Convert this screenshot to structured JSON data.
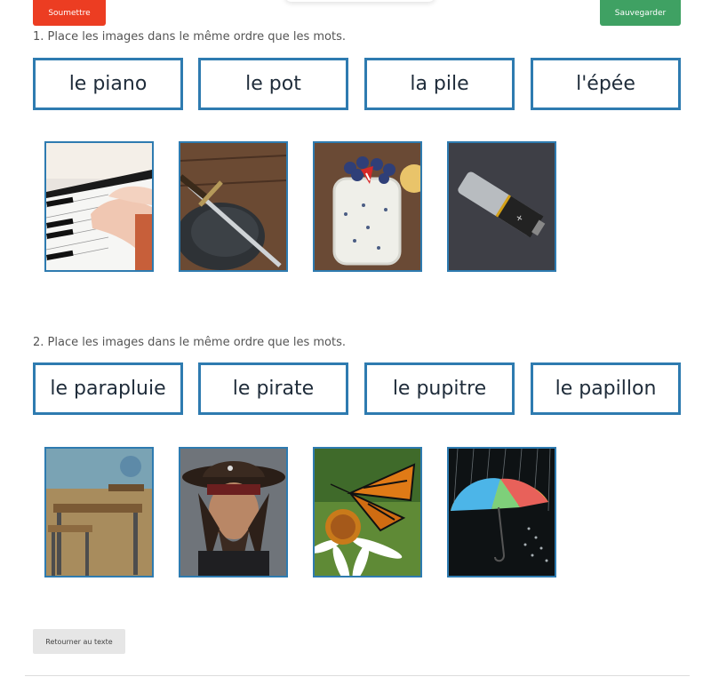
{
  "header": {
    "submit_label": "Soumettre",
    "save_label": "Sauvegarder"
  },
  "colors": {
    "submit": "#ec3d22",
    "save": "#3fa163",
    "border": "#2e7bb0"
  },
  "exercises": [
    {
      "instruction": "1. Place les images dans le même ordre que les mots.",
      "words": [
        "le piano",
        "le pot",
        "la pile",
        "l'épée"
      ],
      "images": [
        "piano-image",
        "sword-image",
        "yogurt-jar-image",
        "battery-image"
      ]
    },
    {
      "instruction": "2. Place les images dans le même ordre que les mots.",
      "words": [
        "le parapluie",
        "le pirate",
        "le pupitre",
        "le papillon"
      ],
      "images": [
        "desk-image",
        "pirate-image",
        "butterfly-image",
        "umbrella-image"
      ]
    }
  ],
  "footer": {
    "back_label": "Retourner au texte"
  }
}
